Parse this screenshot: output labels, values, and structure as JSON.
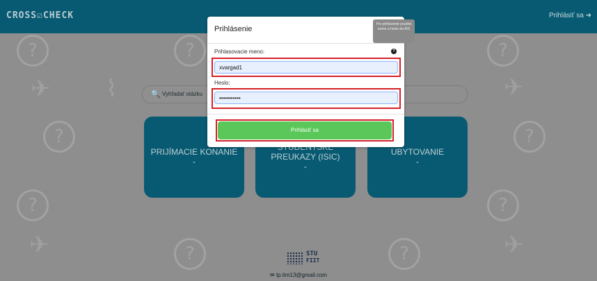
{
  "header": {
    "logo": "CROSS☑CHECK",
    "login_link": "Prihlásiť sa ➜"
  },
  "search": {
    "icon": "search-icon",
    "placeholder": "Vyhľadať otázku"
  },
  "categories": [
    {
      "label": "PRIJÍMACIE KONANIE",
      "chevron": "⌄"
    },
    {
      "label": "ŠTUDENTSKÉ PREUKAZY (ISIC)",
      "chevron": "⌄"
    },
    {
      "label": "UBYTOVANIE",
      "chevron": "⌄"
    }
  ],
  "modal": {
    "title": "Prihlásenie",
    "tooltip": "Pre prihlásenie použite meno a heslo do AIS",
    "username_label": "Prihlasovacie meno:",
    "username_value": "xvargad1",
    "password_label": "Heslo:",
    "password_value": "•••••••••••",
    "submit_label": "Prihlásiť sa",
    "help_icon": "question-circle-icon"
  },
  "footer": {
    "logo_line1": "STU",
    "logo_line2": "FIIT",
    "email": "tp.tim13@gmail.com",
    "mail_icon": "envelope-icon"
  },
  "colors": {
    "primary": "#075a72",
    "submit": "#5bc75a",
    "highlight": "#d51f26",
    "overlay": "#8e8e8e"
  }
}
